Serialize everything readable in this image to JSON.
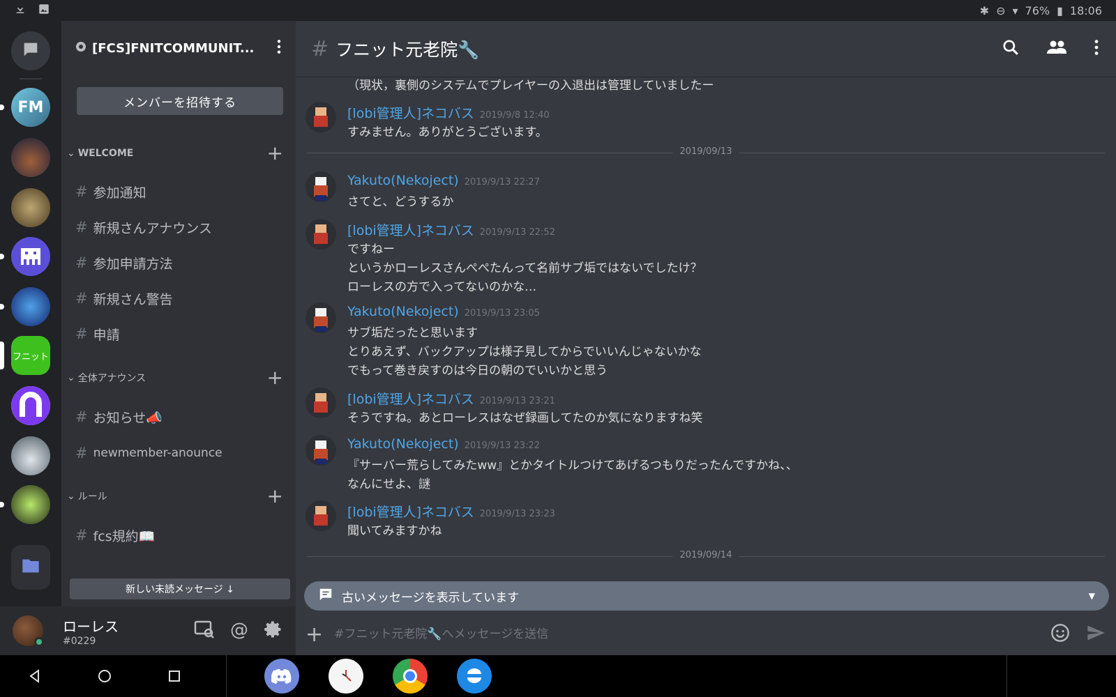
{
  "status_bar": {
    "battery": "76%",
    "time": "18:06"
  },
  "guild": {
    "name": "[FCS]FNITCOMMUNIT...",
    "invite_label": "メンバーを招待する"
  },
  "categories": [
    {
      "label": "WELCOME",
      "channels": [
        "参加通知",
        "新規さんアナウンス",
        "参加申請方法",
        "新規さん警告",
        "申請"
      ]
    },
    {
      "label": "全体アナウンス",
      "channels": [
        "お知らせ📣",
        "newmember-anounce"
      ]
    },
    {
      "label": "ルール",
      "channels": [
        "fcs規約📖"
      ]
    }
  ],
  "unread_bar": "新しい未読メッセージ ↓",
  "rail": {
    "active_server_label": "フニット"
  },
  "user": {
    "name": "ローレス",
    "tag": "#0229"
  },
  "chat": {
    "channel_title": "フニット元老院🔧",
    "top_cut_line": "（現状，裏側のシステムでプレイヤーの入退出は管理していましたー",
    "date_dividers": [
      "2019/09/13",
      "2019/09/14"
    ],
    "messages": [
      {
        "author": "[lobi管理人]ネコバス",
        "time": "2019/9/8 12:40",
        "lines": [
          "すみません。ありがとうございます。"
        ]
      },
      {
        "author": "Yakuto(Nekoject)",
        "time": "2019/9/13 22:27",
        "lines": [
          "さてと、どうするか"
        ]
      },
      {
        "author": "[lobi管理人]ネコバス",
        "time": "2019/9/13 22:52",
        "lines": [
          "ですねー",
          "というかローレスさんぺぺたんって名前サブ垢ではないでしたけ？",
          "ローレスの方で入ってないのかな…"
        ]
      },
      {
        "author": "Yakuto(Nekoject)",
        "time": "2019/9/13 23:05",
        "lines": [
          "サブ垢だったと思います",
          "とりあえず、バックアップは様子見してからでいいんじゃないかな",
          "でもって巻き戻すのは今日の朝のでいいかと思う"
        ]
      },
      {
        "author": "[lobi管理人]ネコバス",
        "time": "2019/9/13 23:21",
        "lines": [
          "そうですね。あとローレスはなぜ録画してたのか気になりますね笑"
        ]
      },
      {
        "author": "Yakuto(Nekoject)",
        "time": "2019/9/13 23:22",
        "lines": [
          "『サーバー荒らしてみたww』とかタイトルつけてあげるつもりだったんですかね、、",
          "なんにせよ、謎"
        ]
      },
      {
        "author": "[lobi管理人]ネコバス",
        "time": "2019/9/13 23:23",
        "lines": [
          "聞いてみますかね"
        ]
      }
    ],
    "old_messages_banner": "古いメッセージを表示しています",
    "composer_placeholder": "#フニット元老院🔧へメッセージを送信"
  },
  "colors": {
    "accent": "#4fa6e8",
    "active_server": "#3ec11f",
    "online": "#43b581"
  },
  "icons": [
    "download-icon",
    "image-icon",
    "bluetooth-icon",
    "dnd-icon",
    "wifi-icon",
    "battery-icon",
    "search-icon",
    "members-icon",
    "more-icon",
    "plus-icon",
    "emoji-icon",
    "send-icon",
    "gear-icon",
    "mention-icon",
    "inbox-icon"
  ]
}
